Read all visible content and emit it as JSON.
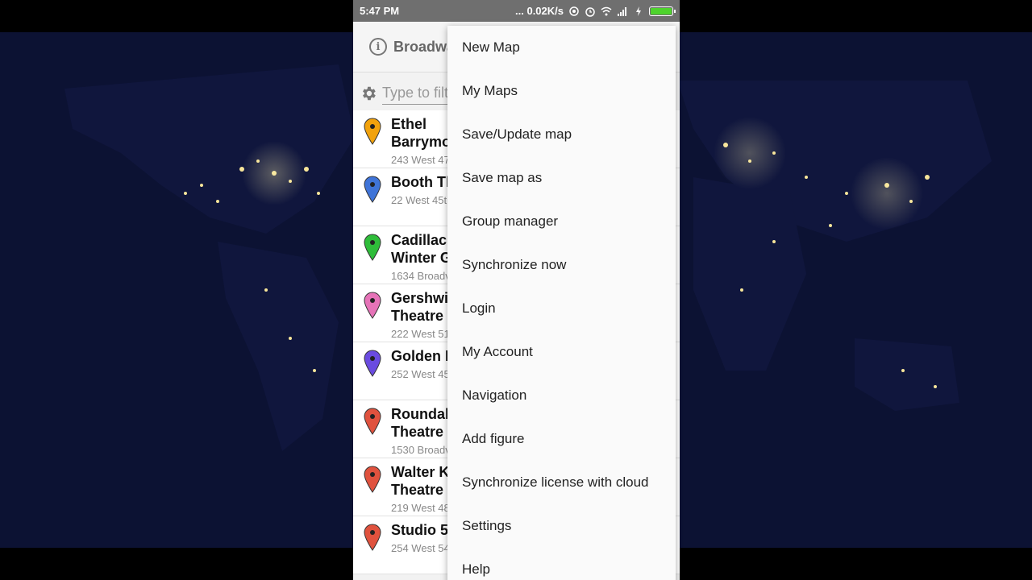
{
  "status_bar": {
    "time": "5:47 PM",
    "net_speed": "... 0.02K/s"
  },
  "toolbar": {
    "title": "Broadwa"
  },
  "filter": {
    "placeholder": "Type to filt"
  },
  "locations": [
    {
      "name": "Ethel\nBarrymo",
      "address": "243 West 47",
      "pin_color": "#f2a20c",
      "lines": 2
    },
    {
      "name": "Booth Th",
      "address": "22 West 45t",
      "pin_color": "#3f74d8",
      "lines": 1
    },
    {
      "name": "Cadillac\nWinter G",
      "address": "1634 Broadv",
      "pin_color": "#2fbd3a",
      "lines": 2
    },
    {
      "name": "Gershwin\nTheatre",
      "address": "222 West 51",
      "pin_color": "#e673b8",
      "lines": 2
    },
    {
      "name": "Golden R",
      "address": "252 West 45",
      "pin_color": "#6a4be0",
      "lines": 1
    },
    {
      "name": "Roundab\nTheatre",
      "address": "1530 Broadv",
      "pin_color": "#e0523e",
      "lines": 2
    },
    {
      "name": "Walter K\nTheatre",
      "address": "219 West 48",
      "pin_color": "#e0523e",
      "lines": 2
    },
    {
      "name": "Studio 54",
      "address": "254 West 54",
      "pin_color": "#e0523e",
      "lines": 1
    }
  ],
  "menu": [
    "New Map",
    "My Maps",
    "Save/Update map",
    "Save map as",
    "Group manager",
    "Synchronize now",
    "Login",
    "My Account",
    "Navigation",
    "Add figure",
    "Synchronize license with cloud",
    "Settings",
    "Help"
  ],
  "colors": {
    "status_bar": "#6f6f6f",
    "battery": "#4ed32d",
    "wallpaper": "#0b1030"
  }
}
